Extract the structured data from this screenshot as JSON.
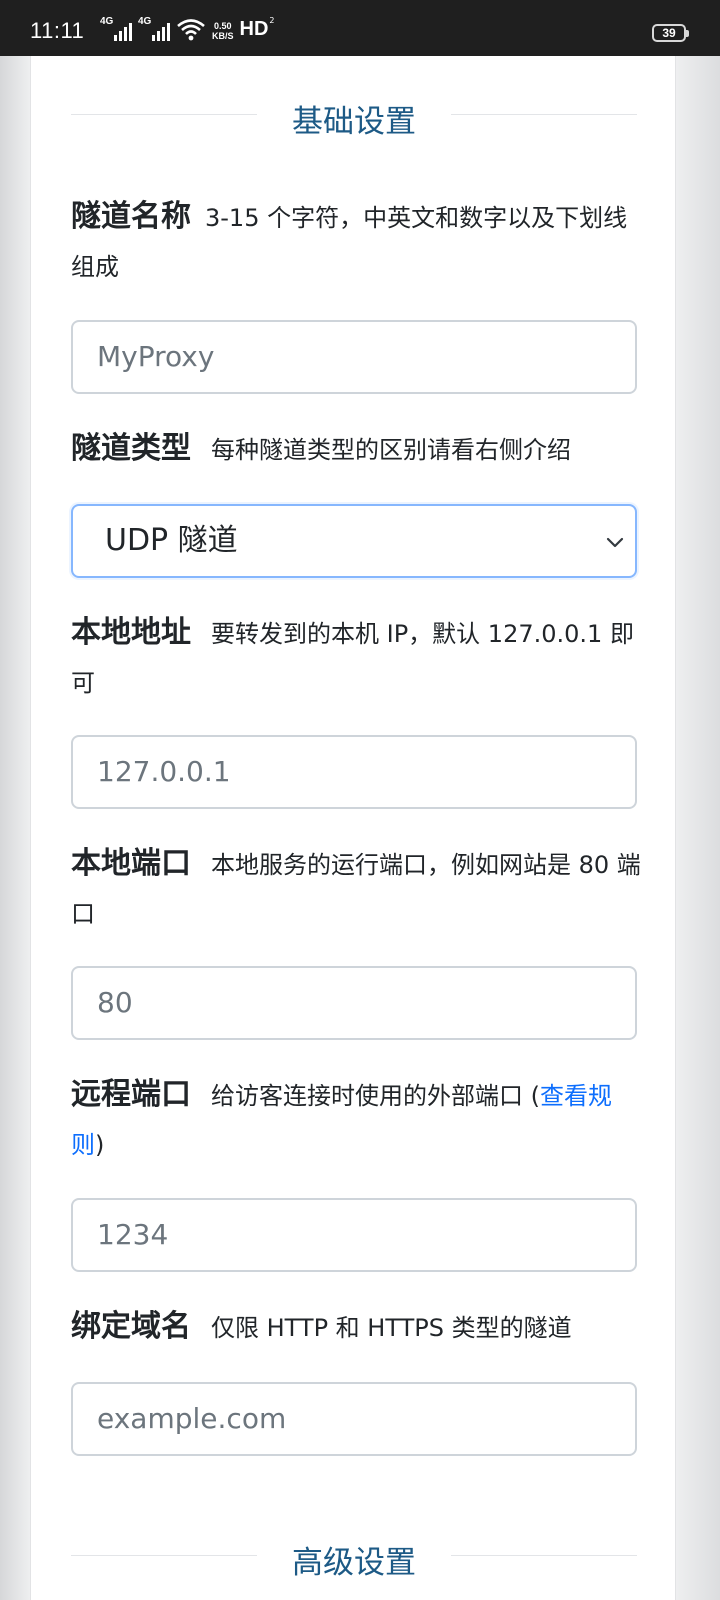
{
  "status_bar": {
    "time": "11:11",
    "network1": "4G",
    "network2": "4G",
    "speed_value": "0.50",
    "speed_unit": "KB/S",
    "hd": "HD",
    "hd_sub": "2",
    "battery": "39"
  },
  "sections": {
    "basic_title": "基础设置",
    "advanced_title": "高级设置"
  },
  "fields": {
    "tunnel_name": {
      "label": "隧道名称",
      "hint": "3-15 个字符，中英文和数字以及下划线组成",
      "placeholder": "MyProxy"
    },
    "tunnel_type": {
      "label": "隧道类型",
      "hint": "每种隧道类型的区别请看右侧介绍",
      "selected": "UDP 隧道"
    },
    "local_address": {
      "label": "本地地址",
      "hint": "要转发到的本机 IP，默认 127.0.0.1 即可",
      "placeholder": "127.0.0.1"
    },
    "local_port": {
      "label": "本地端口",
      "hint": "本地服务的运行端口，例如网站是 80 端口",
      "placeholder": "80"
    },
    "remote_port": {
      "label": "远程端口",
      "hint_before": "给访客连接时使用的外部端口 (",
      "hint_link": "查看规则",
      "hint_after": ")",
      "placeholder": "1234"
    },
    "bind_domain": {
      "label": "绑定域名",
      "hint": "仅限 HTTP 和 HTTPS 类型的隧道",
      "placeholder": "example.com"
    }
  },
  "colors": {
    "section_title": "#1d5a86",
    "link": "#0d6efd",
    "focus_border": "#86b7fe",
    "status_bar": "#1f1f1f"
  }
}
